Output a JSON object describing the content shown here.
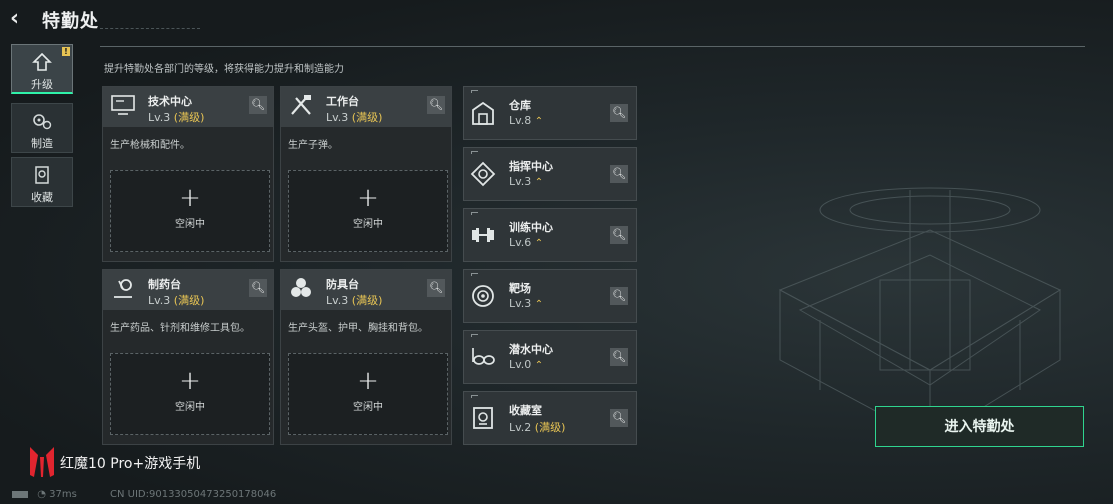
{
  "header": {
    "title": "特勤处",
    "subtitle": "提升特勤处各部门的等级，将获得能力提升和制造能力"
  },
  "tabs": [
    {
      "label": "升级",
      "icon": "upgrade-icon",
      "active": true,
      "badge": "!"
    },
    {
      "label": "制造",
      "icon": "gears-icon",
      "active": false
    },
    {
      "label": "收藏",
      "icon": "collection-icon",
      "active": false
    }
  ],
  "cards": [
    {
      "name": "技术中心",
      "level": "Lv.3",
      "max": "(满级)",
      "icon": "monitor-icon",
      "desc": "生产枪械和配件。",
      "slot": "空闲中"
    },
    {
      "name": "工作台",
      "level": "Lv.3",
      "max": "(满级)",
      "icon": "tools-icon",
      "desc": "生产子弹。",
      "slot": "空闲中"
    },
    {
      "name": "制药台",
      "level": "Lv.3",
      "max": "(满级)",
      "icon": "microscope-icon",
      "desc": "生产药品、针剂和维修工具包。",
      "slot": "空闲中"
    },
    {
      "name": "防具台",
      "level": "Lv.3",
      "max": "(满级)",
      "icon": "armor-icon",
      "desc": "生产头盔、护甲、胸挂和背包。",
      "slot": "空闲中"
    }
  ],
  "facilities": [
    {
      "name": "仓库",
      "level": "Lv.8",
      "max": "",
      "icon": "warehouse-icon",
      "upgradable": true
    },
    {
      "name": "指挥中心",
      "level": "Lv.3",
      "max": "",
      "icon": "command-icon",
      "upgradable": true
    },
    {
      "name": "训练中心",
      "level": "Lv.6",
      "max": "",
      "icon": "dumbbell-icon",
      "upgradable": true
    },
    {
      "name": "靶场",
      "level": "Lv.3",
      "max": "",
      "icon": "target-icon",
      "upgradable": true
    },
    {
      "name": "潜水中心",
      "level": "Lv.0",
      "max": "",
      "icon": "diving-mask-icon",
      "upgradable": true
    },
    {
      "name": "收藏室",
      "level": "Lv.2",
      "max": "(满级)",
      "icon": "vault-icon",
      "upgradable": false
    }
  ],
  "enter_button": "进入特勤处",
  "footer": {
    "brand": "红魔10 Pro+游戏手机",
    "ping": "37ms",
    "uid": "CN UID:90133050473250178046"
  },
  "colors": {
    "accent": "#2fd48f",
    "max_level": "#e7c454"
  }
}
